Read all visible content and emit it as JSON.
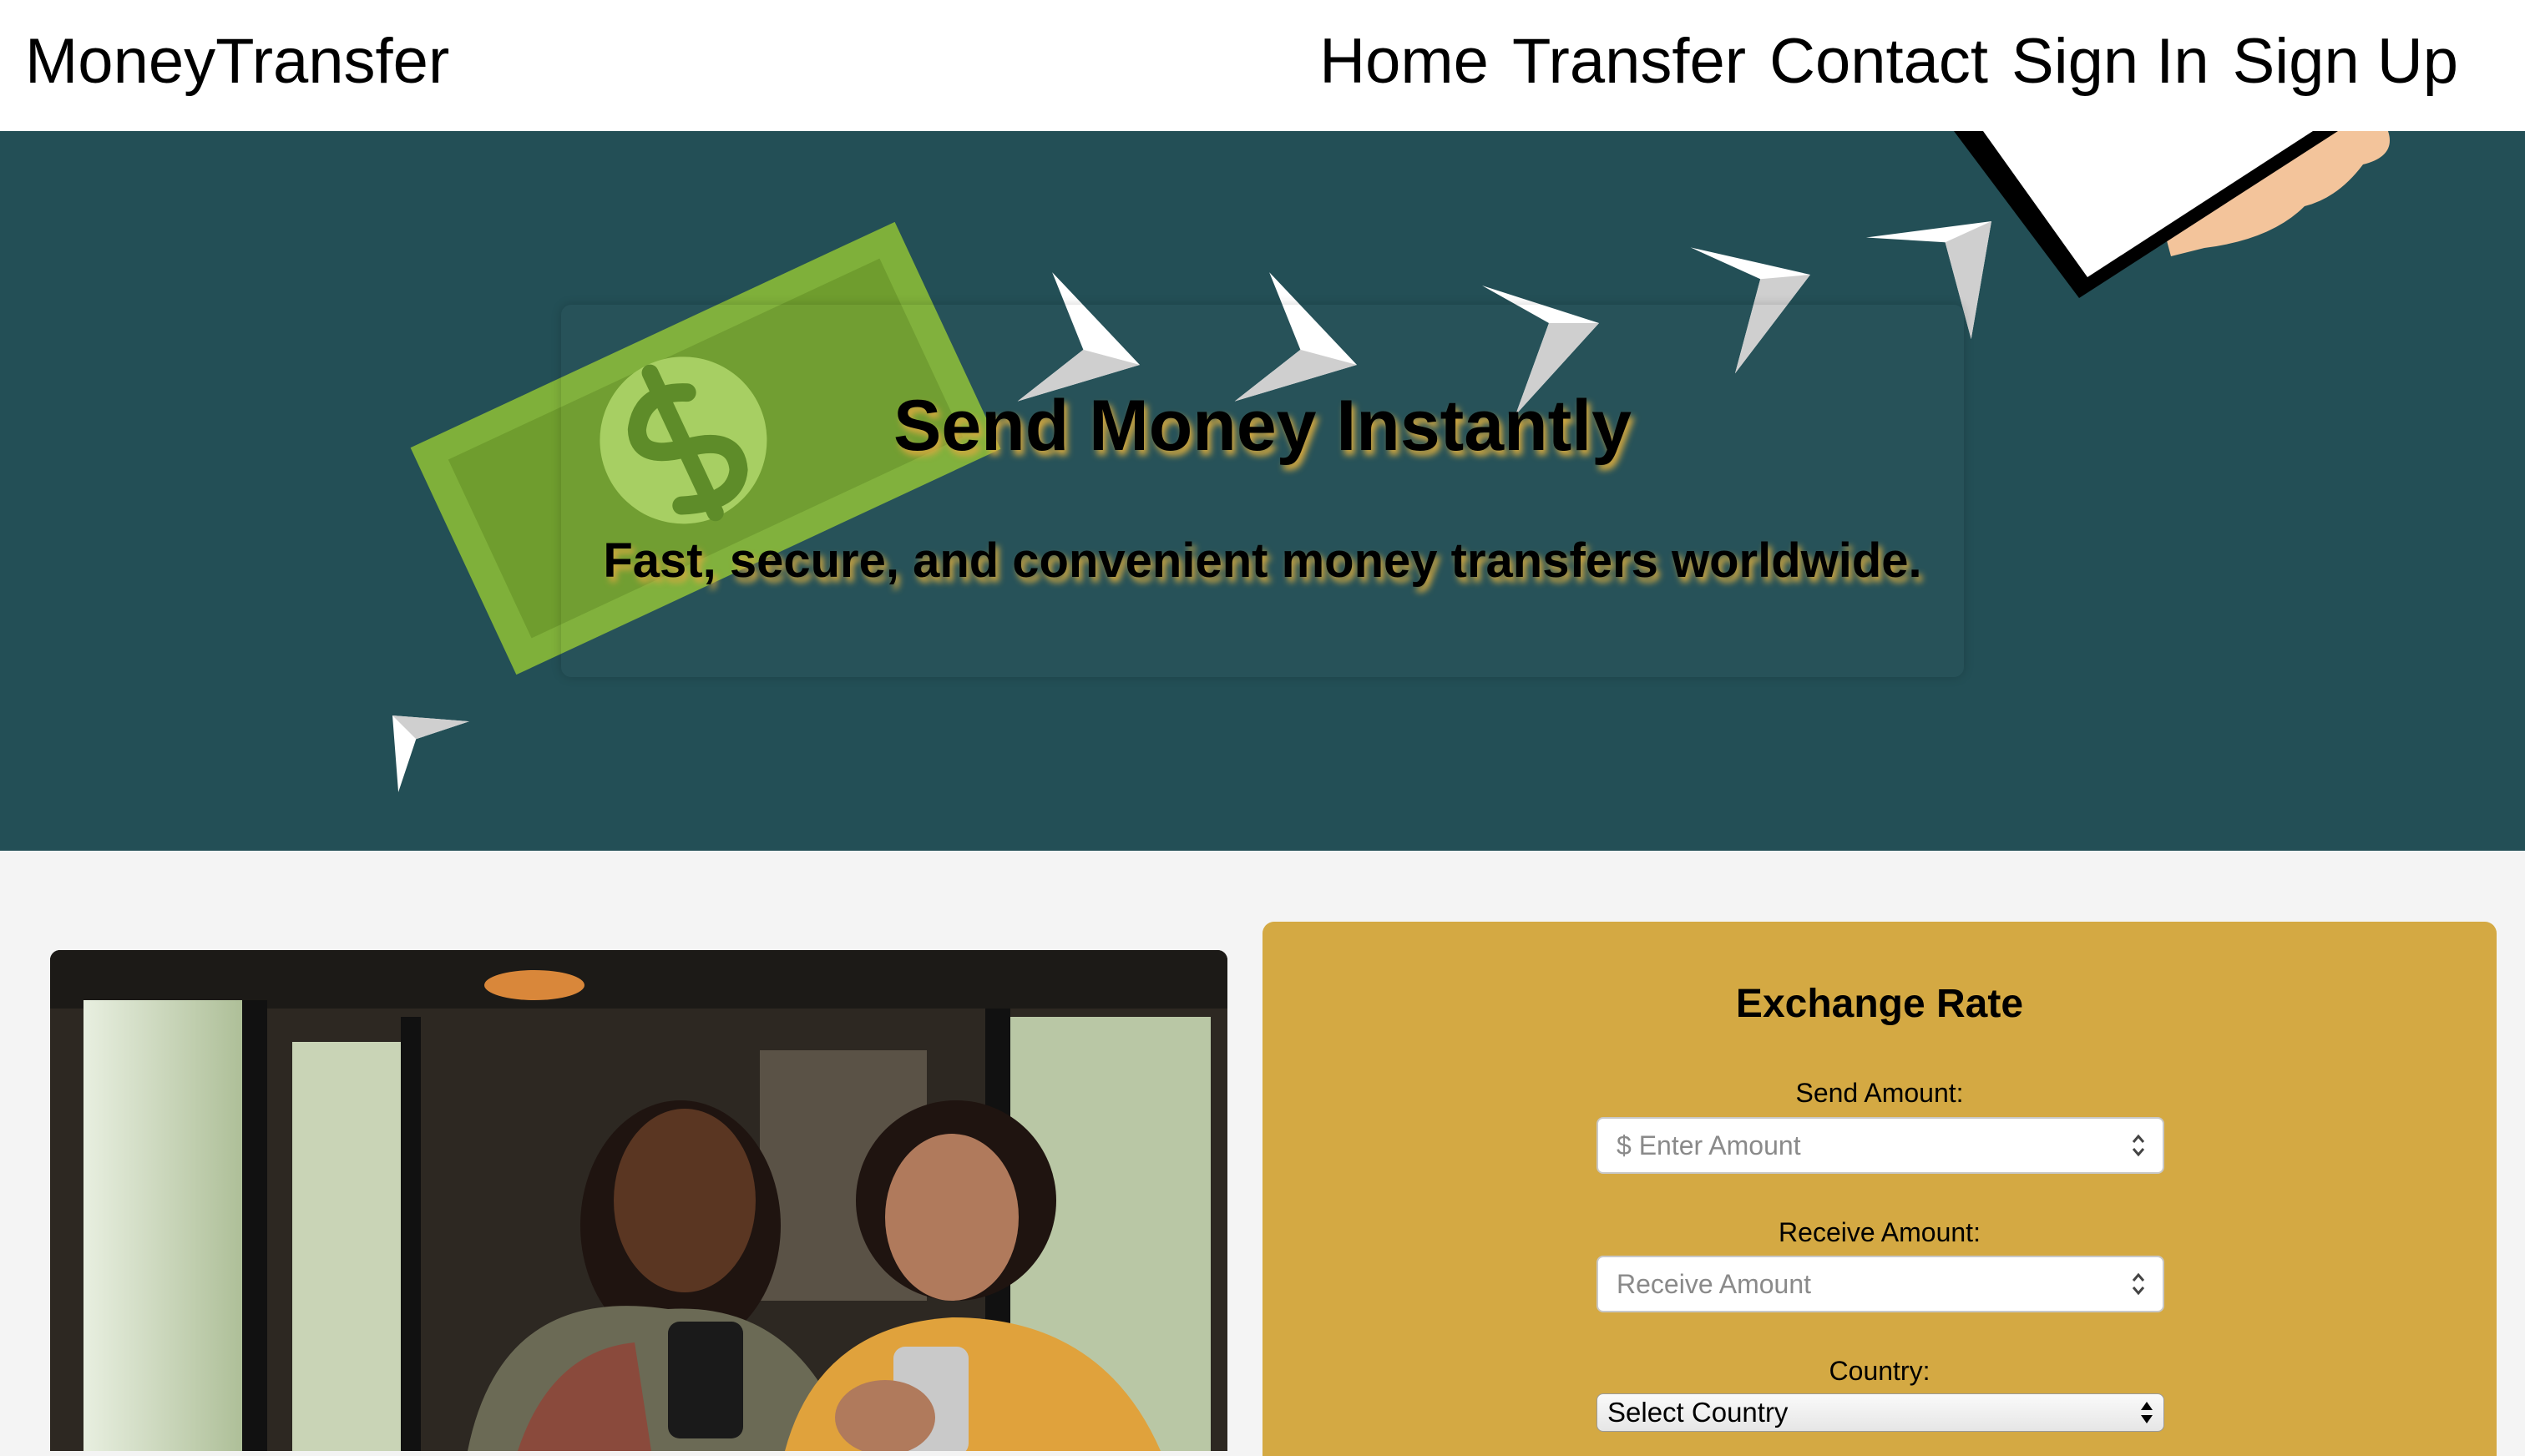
{
  "nav": {
    "brand": "MoneyTransfer",
    "links": [
      {
        "label": "Home"
      },
      {
        "label": "Transfer"
      },
      {
        "label": "Contact"
      },
      {
        "label": "Sign In"
      },
      {
        "label": "Sign Up"
      }
    ]
  },
  "hero": {
    "title": "Send Money Instantly",
    "subtitle": "Fast, secure, and convenient money transfers worldwide.",
    "background_color": "#234f56",
    "text_shadow_color": "#d5a93f"
  },
  "exchange": {
    "title": "Exchange Rate",
    "send_label": "Send Amount:",
    "send_placeholder": "$ Enter Amount",
    "receive_label": "Receive Amount:",
    "receive_placeholder": "Receive Amount",
    "country_label": "Country:",
    "country_selected": "Select Country",
    "panel_color": "#d4a943"
  }
}
